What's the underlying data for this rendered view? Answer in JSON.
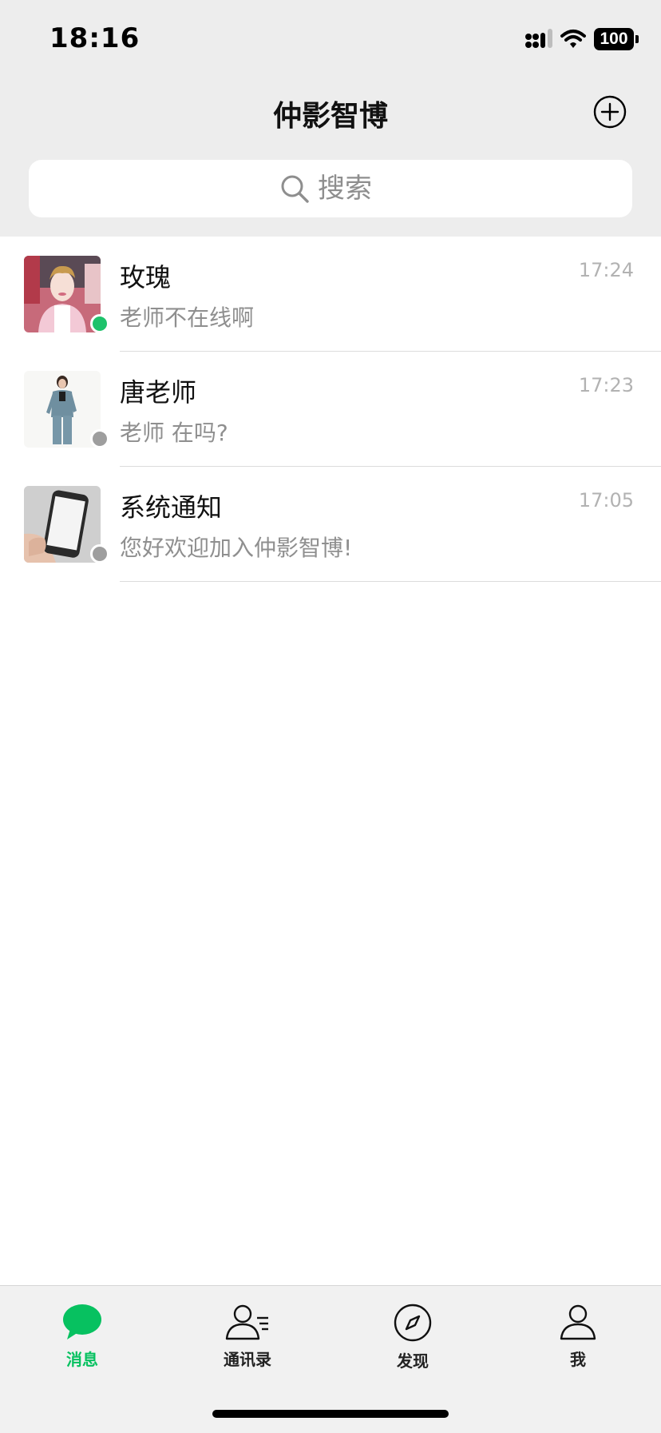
{
  "status_bar": {
    "time": "18:16",
    "battery": "100"
  },
  "header": {
    "title": "仲影智博"
  },
  "search": {
    "placeholder": "搜索"
  },
  "chats": [
    {
      "name": "玫瑰",
      "preview": "老师不在线啊",
      "time": "17:24",
      "online": true
    },
    {
      "name": "唐老师",
      "preview": "老师 在吗?",
      "time": "17:23",
      "online": false
    },
    {
      "name": "系统通知",
      "preview": "您好欢迎加入仲影智博!",
      "time": "17:05",
      "online": false
    }
  ],
  "tabs": [
    {
      "label": "消息",
      "icon": "chat-bubble-icon",
      "active": true
    },
    {
      "label": "通讯录",
      "icon": "contacts-icon",
      "active": false
    },
    {
      "label": "发现",
      "icon": "compass-icon",
      "active": false
    },
    {
      "label": "我",
      "icon": "person-icon",
      "active": false
    }
  ],
  "colors": {
    "accent": "#07c160",
    "online": "#1ec26b",
    "offline": "#9e9e9e",
    "header_bg": "#ededed"
  }
}
